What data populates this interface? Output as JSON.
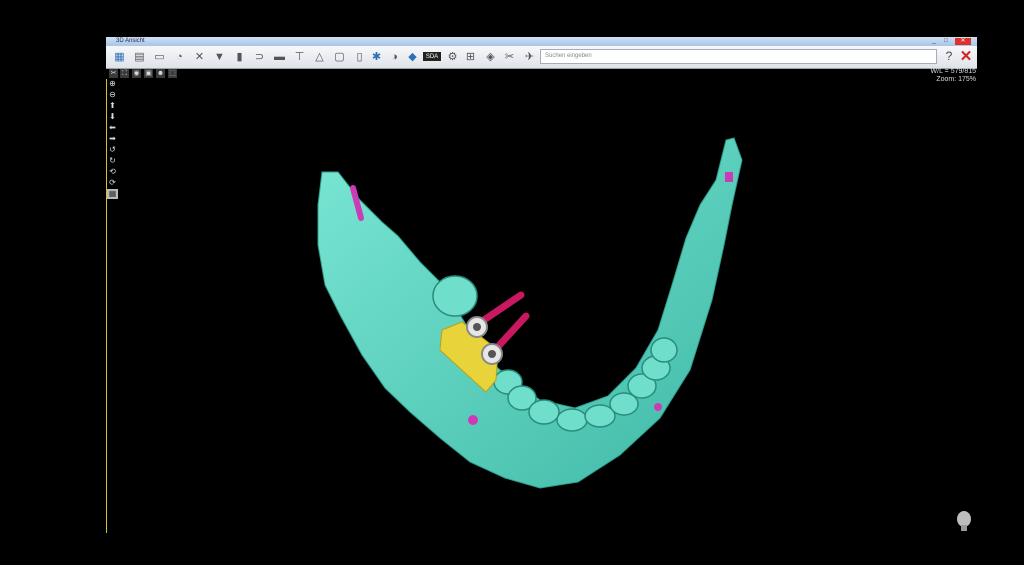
{
  "window": {
    "title": "3D Ansicht",
    "min": "_",
    "max": "□",
    "close": "✕"
  },
  "toolbar": {
    "icons": [
      "layout-icon",
      "save-icon",
      "ruler-icon",
      "camera-icon",
      "tools-icon",
      "implant-icon",
      "measure-icon",
      "stack-icon",
      "nerve-icon",
      "panorama-icon",
      "crosssection-icon",
      "triangle-icon",
      "export-icon",
      "cylinder-icon",
      "axis-icon",
      "sphere-icon",
      "3d-icon",
      "mode-icon",
      "gear-icon",
      "sleeve-icon",
      "guide-icon",
      "scissors-icon",
      "plane-icon"
    ],
    "search_placeholder": "Suchen eingeben",
    "mode_label": "3D",
    "text_badge": "SDA",
    "help": "?",
    "close": "✕"
  },
  "view_tools": [
    "✂",
    "⛶",
    "◉",
    "▣",
    "☻",
    "⬚"
  ],
  "left_tools": [
    "⊕",
    "⊖",
    "⬆",
    "⬇",
    "⬅",
    "➡",
    "↺",
    "↻",
    "⟲",
    "⟳",
    "▦"
  ],
  "info": {
    "wl": "W/L = 579/815",
    "zoom": "Zoom: 175%"
  },
  "colors": {
    "bone": "#58d6c2",
    "implant": "#c8185f",
    "guide": "#e8d43a",
    "sleeve": "#e6e6e6",
    "pin": "#cc3bb6"
  }
}
